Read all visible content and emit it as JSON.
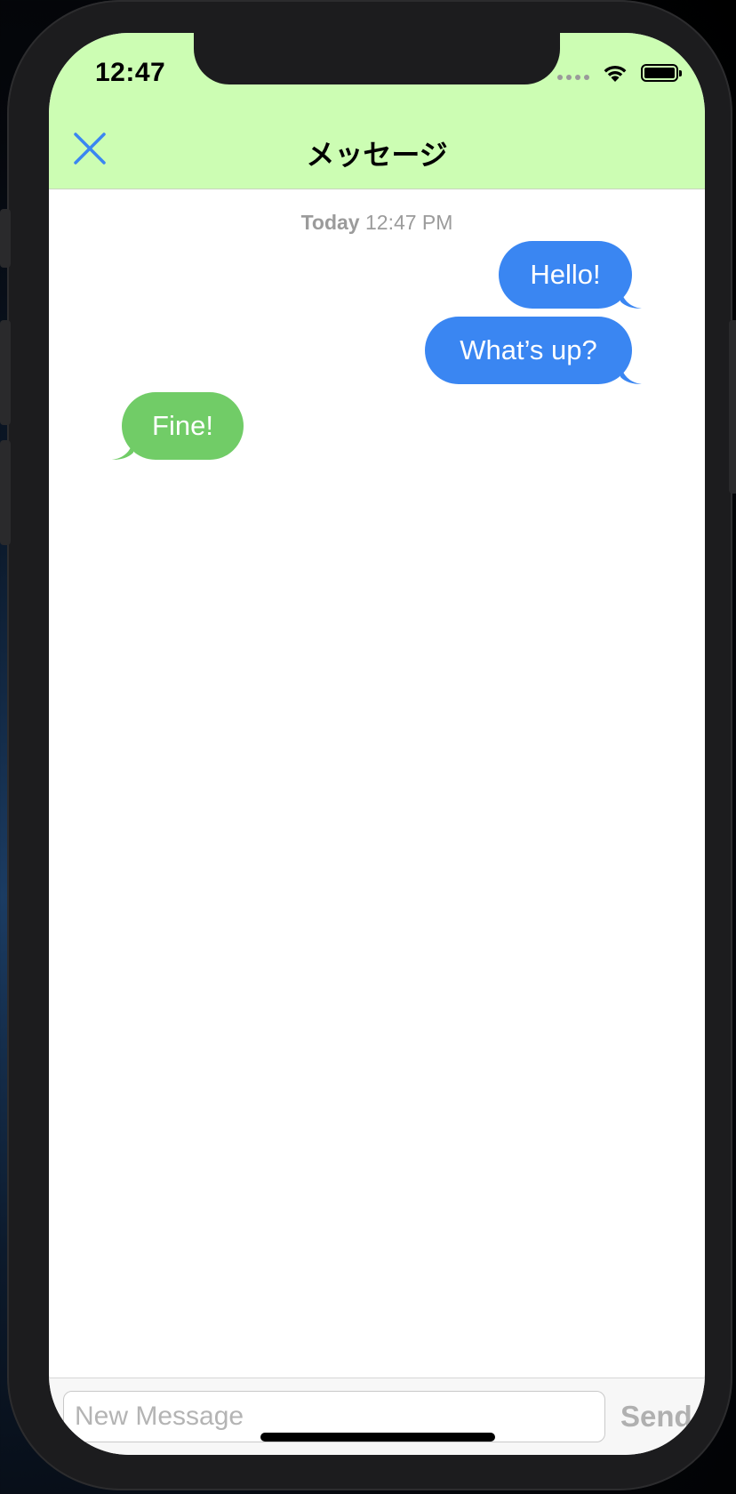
{
  "status_bar": {
    "time": "12:47"
  },
  "nav": {
    "title": "メッセージ",
    "close_icon": "close-icon"
  },
  "chat": {
    "timestamp_day": "Today",
    "timestamp_time": "12:47 PM",
    "messages": [
      {
        "text": "Hello!",
        "direction": "outgoing"
      },
      {
        "text": "What’s up?",
        "direction": "outgoing"
      },
      {
        "text": "Fine!",
        "direction": "incoming"
      }
    ]
  },
  "composer": {
    "placeholder": "New Message",
    "send_label": "Send"
  },
  "colors": {
    "header_bg": "#ccfdb3",
    "outgoing_bubble": "#3a86f2",
    "incoming_bubble": "#71cc67",
    "accent": "#3a86f2"
  }
}
